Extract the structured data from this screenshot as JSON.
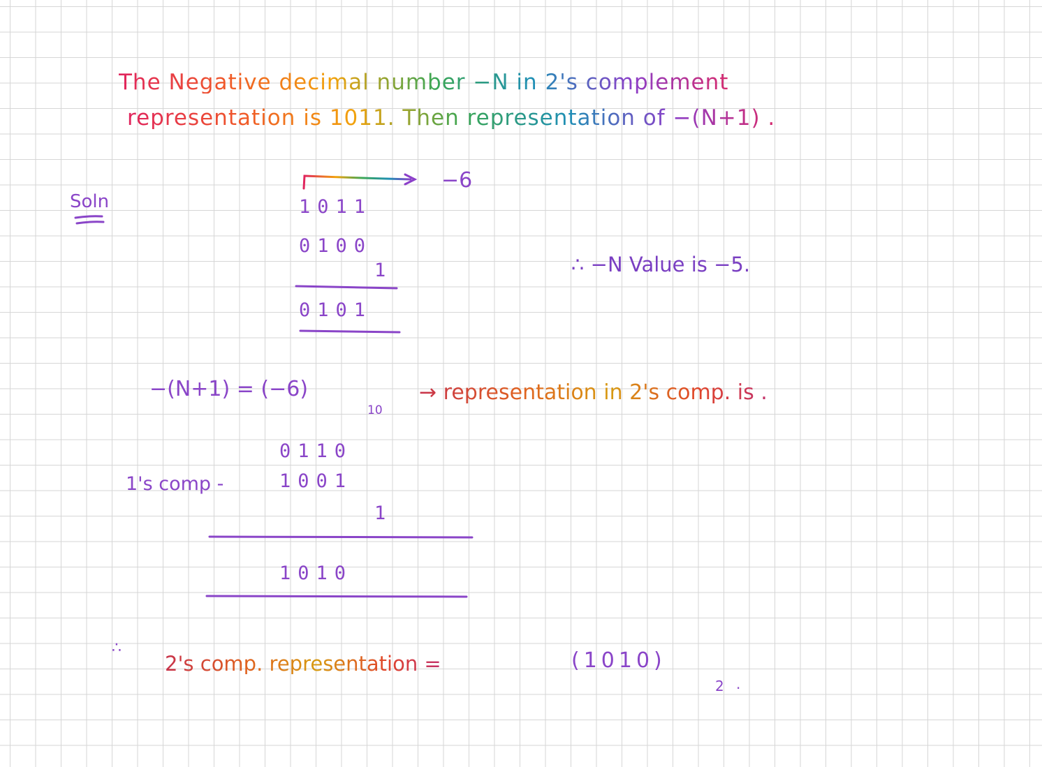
{
  "question": {
    "line1": "The Negative decimal number −N in 2's complement",
    "line2": "representation is 1011. Then representation of −(N+1) ."
  },
  "solution": {
    "label": "Soln",
    "arrow_value": "−6",
    "rows_a": [
      "1011",
      "0100",
      "1",
      "0101"
    ],
    "conclusion_n": "∴ −N Value is −5.",
    "lhs": "−(N+1) = (−6)",
    "lhs_subscript": "10",
    "rhs": "→ representation in 2's comp. is .",
    "rows_b": [
      "0110",
      "1001",
      "1",
      "1010"
    ],
    "ones_comp_label": "1's comp -",
    "final_prefix": "∴",
    "final_text": "2's comp. representation =",
    "final_value": "(1010)",
    "final_subscript": "2",
    "final_dot": "."
  },
  "colors": {
    "ink_purple": "#8a45c8",
    "ink_rainbow": [
      "#e0245e",
      "#f05a28",
      "#f2a20c",
      "#3aa655",
      "#1f8fb5",
      "#8b3fc9"
    ]
  }
}
